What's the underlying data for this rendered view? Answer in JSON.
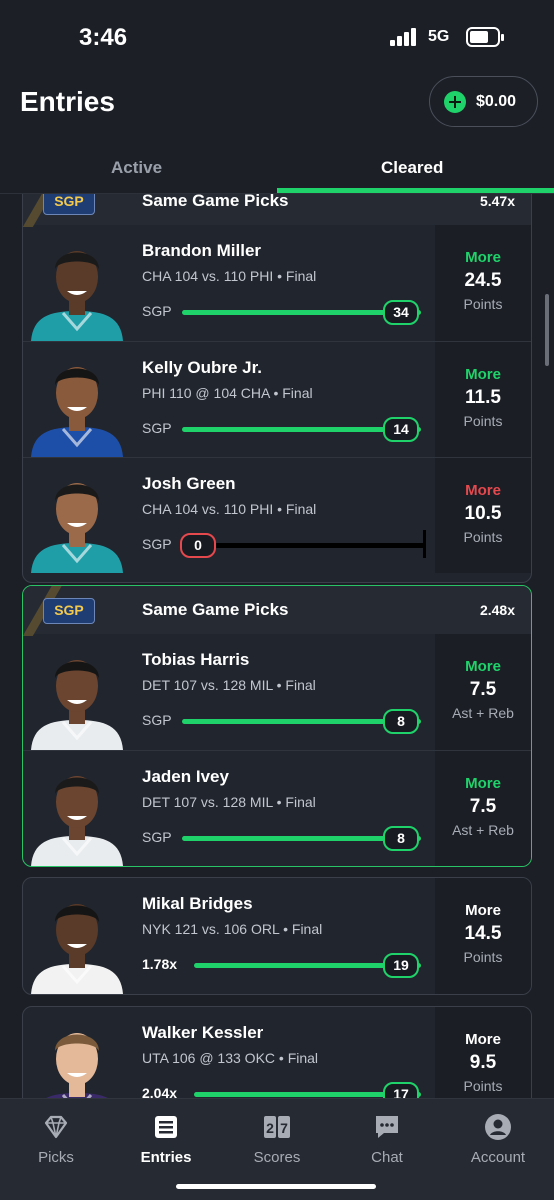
{
  "status": {
    "time": "3:46",
    "network": "5G"
  },
  "header": {
    "title": "Entries",
    "balance": "$0.00"
  },
  "tabs": [
    {
      "label": "Active"
    },
    {
      "label": "Cleared"
    }
  ],
  "entries": [
    {
      "badge": "SGP",
      "label": "Same Game Picks",
      "multiplier": "5.47x",
      "picks": [
        {
          "name": "Brandon Miller",
          "game": "CHA 104 vs. 110 PHI • Final",
          "left": "SGP",
          "value": "34",
          "pick": "More",
          "line": "24.5",
          "stat": "Points",
          "result": "hit",
          "progress": 1.0,
          "jersey": "#1f9ea8",
          "skin": "#5a3b29",
          "hair": "#1a1a1a"
        },
        {
          "name": "Kelly Oubre Jr.",
          "game": "PHI 110 @ 104 CHA • Final",
          "left": "SGP",
          "value": "14",
          "pick": "More",
          "line": "11.5",
          "stat": "Points",
          "result": "hit",
          "progress": 1.0,
          "jersey": "#1e4fa8",
          "skin": "#8a5a3c",
          "hair": "#151515"
        },
        {
          "name": "Josh Green",
          "game": "CHA 104 vs. 110 PHI • Final",
          "left": "SGP",
          "value": "0",
          "pick": "More",
          "line": "10.5",
          "stat": "Points",
          "result": "miss",
          "progress": 0.0,
          "jersey": "#1f9ea8",
          "skin": "#9a6a4a",
          "hair": "#1a1a1a"
        }
      ]
    },
    {
      "badge": "SGP",
      "label": "Same Game Picks",
      "multiplier": "2.48x",
      "picks": [
        {
          "name": "Tobias Harris",
          "game": "DET 107 vs. 128 MIL • Final",
          "left": "SGP",
          "value": "8",
          "pick": "More",
          "line": "7.5",
          "stat": "Ast + Reb",
          "result": "hit",
          "progress": 1.0,
          "jersey": "#e9ecef",
          "skin": "#6b4530",
          "hair": "#151515"
        },
        {
          "name": "Jaden Ivey",
          "game": "DET 107 vs. 128 MIL • Final",
          "left": "SGP",
          "value": "8",
          "pick": "More",
          "line": "7.5",
          "stat": "Ast + Reb",
          "result": "hit",
          "progress": 1.0,
          "jersey": "#e9ecef",
          "skin": "#6b4530",
          "hair": "#1a1a1a"
        }
      ]
    },
    {
      "picks": [
        {
          "name": "Mikal Bridges",
          "game": "NYK 121 vs. 106 ORL • Final",
          "left": "1.78x",
          "value": "19",
          "pick": "More",
          "line": "14.5",
          "stat": "Points",
          "result": "hit",
          "progress": 1.0,
          "jersey": "#f2f2f2",
          "skin": "#5a3a28",
          "hair": "#151515"
        }
      ]
    },
    {
      "picks": [
        {
          "name": "Walker Kessler",
          "game": "UTA 106 @ 133 OKC • Final",
          "left": "2.04x",
          "value": "17",
          "pick": "More",
          "line": "9.5",
          "stat": "Points",
          "result": "hit",
          "progress": 1.0,
          "jersey": "#3a2a6a",
          "skin": "#e3b99a",
          "hair": "#7a5a3a"
        }
      ]
    }
  ],
  "nav": [
    {
      "label": "Picks",
      "icon": "diamond-icon"
    },
    {
      "label": "Entries",
      "icon": "list-icon"
    },
    {
      "label": "Scores",
      "icon": "scoreboard-icon"
    },
    {
      "label": "Chat",
      "icon": "chat-icon"
    },
    {
      "label": "Account",
      "icon": "account-icon"
    }
  ],
  "colors": {
    "accent": "#1fd36a",
    "miss": "#e5484d",
    "background": "#1c1f26"
  }
}
